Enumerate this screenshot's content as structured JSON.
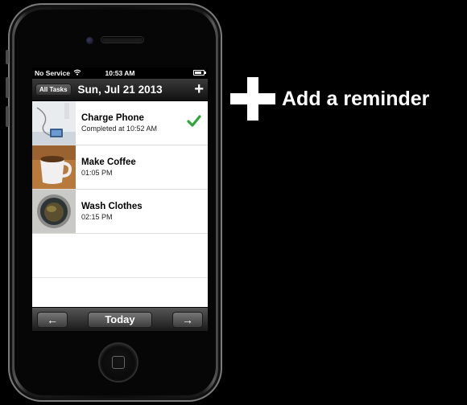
{
  "status_bar": {
    "carrier": "No Service",
    "time": "10:53 AM"
  },
  "nav_bar": {
    "all_tasks_label": "All Tasks",
    "title": "Sun, Jul 21 2013",
    "add_label": "+"
  },
  "tasks": [
    {
      "title": "Charge Phone",
      "subtitle": "Completed at 10:52 AM",
      "completed": true,
      "thumbnail": "phone-charging"
    },
    {
      "title": "Make Coffee",
      "subtitle": "01:05 PM",
      "completed": false,
      "thumbnail": "coffee-mug"
    },
    {
      "title": "Wash Clothes",
      "subtitle": "02:15 PM",
      "completed": false,
      "thumbnail": "washing-machine"
    }
  ],
  "toolbar": {
    "prev_label": "←",
    "today_label": "Today",
    "next_label": "→"
  },
  "caption": {
    "text": "Add a reminder"
  },
  "colors": {
    "check_green": "#2ea43a",
    "background": "#000000"
  }
}
